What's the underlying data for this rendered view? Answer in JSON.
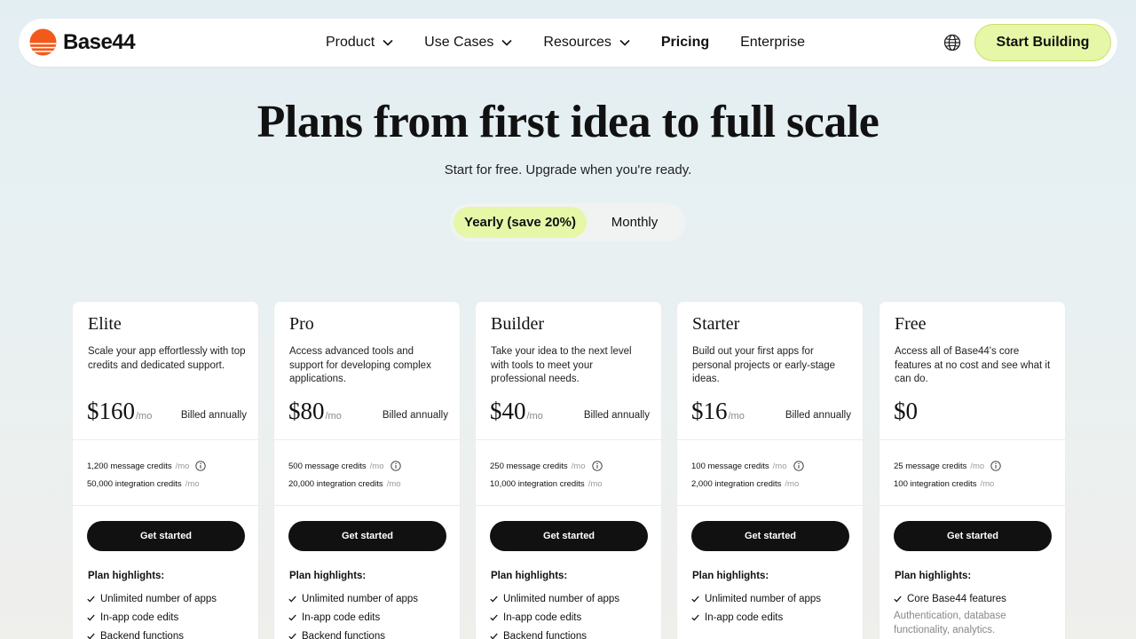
{
  "nav": {
    "logo_text": "Base44",
    "links": [
      {
        "label": "Product",
        "dropdown": true
      },
      {
        "label": "Use Cases",
        "dropdown": true
      },
      {
        "label": "Resources",
        "dropdown": true
      },
      {
        "label": "Pricing",
        "dropdown": false
      },
      {
        "label": "Enterprise",
        "dropdown": false
      }
    ],
    "globe_icon": "globe-icon",
    "cta_label": "Start Building"
  },
  "hero": {
    "title": "Plans from first idea to full scale",
    "subtitle": "Start for free. Upgrade when you're ready."
  },
  "billing_toggle": {
    "yearly_label": "Yearly (save 20%)",
    "monthly_label": "Monthly",
    "selected": "yearly"
  },
  "plans": [
    {
      "name": "Elite",
      "description": "Scale your app effortlessly with top credits and dedicated support.",
      "price": "$160",
      "per": "/mo",
      "billed": "Billed annually",
      "message_credits": "1,200 message credits",
      "message_per": "/mo",
      "integration_credits": "50,000 integration credits",
      "integration_per": "/mo",
      "cta": "Get started",
      "highlights_title": "Plan highlights:",
      "highlights": [
        "Unlimited number of apps",
        "In-app code edits",
        "Backend functions"
      ]
    },
    {
      "name": "Pro",
      "description": "Access advanced tools and support for developing complex applications.",
      "price": "$80",
      "per": "/mo",
      "billed": "Billed annually",
      "message_credits": "500 message credits",
      "message_per": "/mo",
      "integration_credits": "20,000 integration credits",
      "integration_per": "/mo",
      "cta": "Get started",
      "highlights_title": "Plan highlights:",
      "highlights": [
        "Unlimited number of apps",
        "In-app code edits",
        "Backend functions"
      ]
    },
    {
      "name": "Builder",
      "description": "Take your idea to the next level with tools to meet your professional needs.",
      "price": "$40",
      "per": "/mo",
      "billed": "Billed annually",
      "message_credits": "250 message credits",
      "message_per": "/mo",
      "integration_credits": "10,000 integration credits",
      "integration_per": "/mo",
      "cta": "Get started",
      "highlights_title": "Plan highlights:",
      "highlights": [
        "Unlimited number of apps",
        "In-app code edits",
        "Backend functions"
      ]
    },
    {
      "name": "Starter",
      "description": "Build out your first apps for personal projects or early-stage ideas.",
      "price": "$16",
      "per": "/mo",
      "billed": "Billed annually",
      "message_credits": "100 message credits",
      "message_per": "/mo",
      "integration_credits": "2,000 integration credits",
      "integration_per": "/mo",
      "cta": "Get started",
      "highlights_title": "Plan highlights:",
      "highlights": [
        "Unlimited number of apps",
        "In-app code edits"
      ]
    },
    {
      "name": "Free",
      "description": "Access all of Base44's core features at no cost and see what it can do.",
      "price": "$0",
      "per": "",
      "billed": "",
      "message_credits": "25 message credits",
      "message_per": "/mo",
      "integration_credits": "100 integration credits",
      "integration_per": "/mo",
      "cta": "Get started",
      "highlights_title": "Plan highlights:",
      "highlights": [
        "Core Base44 features"
      ],
      "highlights_note": "Authentication, database functionality, analytics."
    }
  ],
  "colors": {
    "accent": "#e6f7a8",
    "logo_orange": "#f25a1c",
    "button_dark": "#111111"
  }
}
